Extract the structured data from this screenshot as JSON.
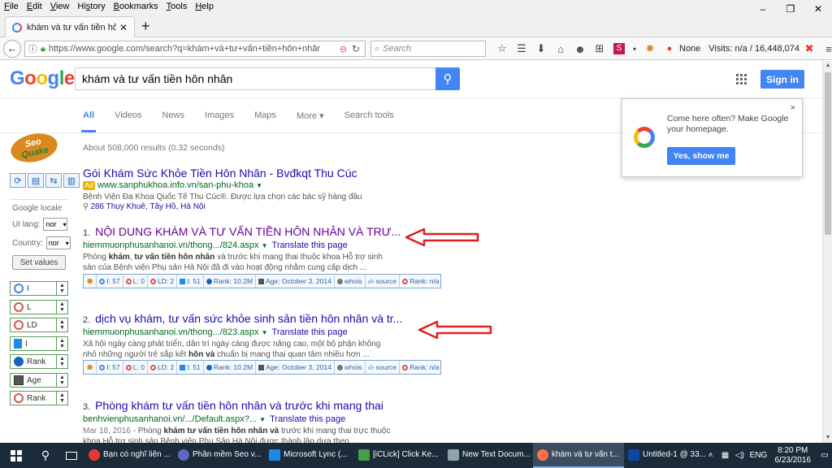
{
  "menubar": {
    "items": [
      {
        "u": "F",
        "rest": "ile"
      },
      {
        "u": "E",
        "rest": "dit"
      },
      {
        "u": "V",
        "rest": "iew"
      },
      {
        "pre": "Hi",
        "u": "s",
        "rest": "tory"
      },
      {
        "u": "B",
        "rest": "ookmarks"
      },
      {
        "u": "T",
        "rest": "ools"
      },
      {
        "u": "H",
        "rest": "elp"
      }
    ]
  },
  "window": {
    "minimize": "–",
    "restore": "❐",
    "close": "✕"
  },
  "tab": {
    "title": "khám và tư vấn tiền hôn nh...",
    "close": "✕",
    "new": "+"
  },
  "nav": {
    "url": "https://www.google.com/search?q=khám+và+tư+vấn+tiền+hôn+nhâr",
    "search_placeholder": "Search",
    "addon_none": "None",
    "visits": "Visits: n/a / 16,448,074"
  },
  "google": {
    "logo": [
      "G",
      "o",
      "o",
      "g",
      "l",
      "e"
    ],
    "query": "khám và tư vấn tiền hôn nhân",
    "signin": "Sign in",
    "tabs": [
      "All",
      "Videos",
      "News",
      "Images",
      "Maps",
      "More ▾",
      "Search tools"
    ],
    "stats": "About 508,000 results (0.32 seconds)"
  },
  "popup": {
    "text": "Come here often? Make Google your homepage.",
    "button": "Yes, show me",
    "close": "×"
  },
  "seoquake": {
    "logo_line1": "Seo",
    "logo_line2": "Quake",
    "locale_title": "Google locale",
    "ui_lang_label": "UI lang:",
    "ui_lang_value": "nor",
    "country_label": "Country:",
    "country_value": "nor",
    "set_values": "Set values",
    "metrics": [
      "I",
      "L",
      "LD",
      "I",
      "Rank",
      "Age",
      "Rank"
    ]
  },
  "ad": {
    "title": "Gói Khám Sức Khỏe Tiền Hôn Nhân - Bvđkqt Thu Cúc",
    "badge": "Ad",
    "url": "www.sanphukhoa.info.vn/san-phu-khoa",
    "snippet": "Bệnh Viện Đa Khoa Quốc Tế Thu Cúc®. Được lựa chọn các bác sỹ hàng đầu",
    "location": "286 Thụy Khuê, Tây Hồ, Hà Nội"
  },
  "results": [
    {
      "num": "1.",
      "title": "NỘI DUNG KHÁM VÀ TƯ VẤN TIỀN HÔN NHÂN VÀ TRƯ...",
      "url": "hiemmuonphusanhanoi.vn/thong.../824.aspx",
      "translate": "Translate this page",
      "snippet_parts": [
        "Phòng ",
        "khám",
        ", ",
        "tư vấn tiền hôn nhân",
        " và trước khi mang thai thuộc khoa Hỗ trợ sinh sản của Bệnh viện Phụ sản Hà Nội đã đi vào hoạt động nhằm cung cấp dịch ..."
      ],
      "sq": {
        "gi": "I: 57",
        "l": "L: 0",
        "ld": "LD: 2",
        "bi": "I: 51",
        "rank": "Rank: 10.2M",
        "age": "Age: October 3, 2014",
        "whois": "whois",
        "source": "source",
        "rank2": "Rank: n/a"
      }
    },
    {
      "num": "2.",
      "title": "dịch vụ khám, tư vấn sức khỏe sinh sản tiền hôn nhân và tr...",
      "url": "hiemmuonphusanhanoi.vn/thong.../823.aspx",
      "translate": "Translate this page",
      "snippet_parts": [
        "Xã hội ngày càng phát triển, dân trí ngày càng được nâng cao, một bộ phận không nhỏ những người trẻ sắp kết ",
        "hôn",
        " ",
        "và",
        " chuẩn bị mang thai quan tâm nhiều hơn ..."
      ],
      "sq": {
        "gi": "I: 57",
        "l": "L: 0",
        "ld": "LD: 2",
        "bi": "I: 51",
        "rank": "Rank: 10.2M",
        "age": "Age: October 3, 2014",
        "whois": "whois",
        "source": "source",
        "rank2": "Rank: n/a"
      }
    },
    {
      "num": "3.",
      "title": "Phòng khám tư vấn tiền hôn nhân và trước khi mang thai",
      "url": "benhvienphusanhanoi.vn/.../Default.aspx?...",
      "translate": "Translate this page",
      "date": "Mar 18, 2016 - ",
      "snippet_parts": [
        "Phòng ",
        "khám tư vấn tiền hôn nhân và",
        " trước khi mang thai trực thuộc khoa Hỗ trợ sinh sản Bệnh viện Phụ Sản Hà Nội được thành lập dựa theo ..."
      ]
    }
  ],
  "taskbar": {
    "tasks": [
      {
        "label": "Bạn có nghĩ liên ...",
        "color": "#e53935"
      },
      {
        "label": "Phần mềm Seo v...",
        "color": "#5c6bc0"
      },
      {
        "label": "Microsoft Lync  (...",
        "color": "#1e88e5"
      },
      {
        "label": "[iCLick] Click Ke...",
        "color": "#43a047"
      },
      {
        "label": "New Text Docum...",
        "color": "#90a4ae"
      },
      {
        "label": "khám và tư vấn t...",
        "color": "#ff7043"
      },
      {
        "label": "Untitled-1 @ 33....",
        "color": "#0d47a1"
      }
    ],
    "lang": "ENG",
    "time": "8:20 PM",
    "date": "6/23/2016"
  },
  "colors": {
    "google_blue": "#4285f4",
    "link": "#1a0dab",
    "visited": "#660099",
    "url_green": "#006621",
    "annotation_red": "#e02020"
  }
}
